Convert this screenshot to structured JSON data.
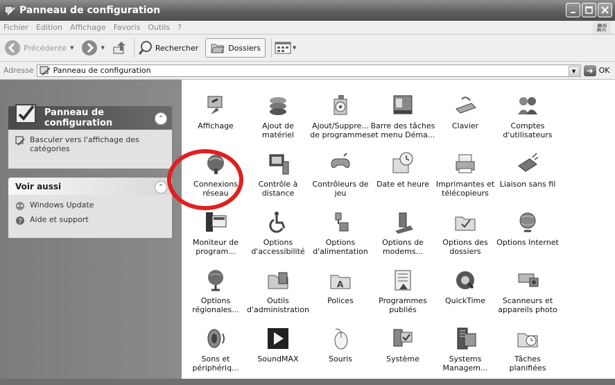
{
  "window": {
    "title": "Panneau de configuration"
  },
  "menu": [
    "Fichier",
    "Edition",
    "Affichage",
    "Favoris",
    "Outils",
    "?"
  ],
  "toolbar": {
    "back_label": "Précédente",
    "search_label": "Rechercher",
    "folders_label": "Dossiers"
  },
  "address": {
    "label": "Adresse",
    "value": "Panneau de configuration",
    "go_label": "OK"
  },
  "left_panel": {
    "control_panel": {
      "title": "Panneau de configuration",
      "switch_view": "Basculer vers l'affichage des catégories"
    },
    "see_also": {
      "title": "Voir aussi",
      "links": [
        "Windows Update",
        "Aide et support"
      ]
    }
  },
  "items": [
    {
      "label": "Affichage",
      "icon": "display-icon"
    },
    {
      "label": "Ajout de matériel",
      "icon": "add-hardware-icon"
    },
    {
      "label": "Ajout/Suppre... de programmes",
      "icon": "add-remove-programs-icon"
    },
    {
      "label": "Barre des tâches et menu Déma...",
      "icon": "taskbar-icon"
    },
    {
      "label": "Clavier",
      "icon": "keyboard-icon"
    },
    {
      "label": "Comptes d'utilisateurs",
      "icon": "user-accounts-icon"
    },
    {
      "label": "Connexions réseau",
      "icon": "network-icon"
    },
    {
      "label": "Contrôle à distance",
      "icon": "remote-control-icon"
    },
    {
      "label": "Contrôleurs de jeu",
      "icon": "gamepad-icon"
    },
    {
      "label": "Date et heure",
      "icon": "clock-icon"
    },
    {
      "label": "Imprimantes et télécopieurs",
      "icon": "printer-icon"
    },
    {
      "label": "Liaison sans fil",
      "icon": "wireless-icon"
    },
    {
      "label": "Moniteur de program...",
      "icon": "monitor-program-icon"
    },
    {
      "label": "Options d'accessibilité",
      "icon": "accessibility-icon"
    },
    {
      "label": "Options d'alimentation",
      "icon": "power-icon"
    },
    {
      "label": "Options de modems...",
      "icon": "modem-icon"
    },
    {
      "label": "Options des dossiers",
      "icon": "folder-options-icon"
    },
    {
      "label": "Options Internet",
      "icon": "internet-options-icon"
    },
    {
      "label": "Options régionales...",
      "icon": "globe-icon"
    },
    {
      "label": "Outils d'administration",
      "icon": "admin-tools-icon"
    },
    {
      "label": "Polices",
      "icon": "fonts-icon"
    },
    {
      "label": "Programmes publiés",
      "icon": "published-programs-icon"
    },
    {
      "label": "QuickTime",
      "icon": "quicktime-icon"
    },
    {
      "label": "Scanneurs et appareils photo",
      "icon": "scanner-icon"
    },
    {
      "label": "Sons et périphériq...",
      "icon": "speaker-icon"
    },
    {
      "label": "SoundMAX",
      "icon": "soundmax-icon"
    },
    {
      "label": "Souris",
      "icon": "mouse-icon"
    },
    {
      "label": "Système",
      "icon": "system-icon"
    },
    {
      "label": "Systems Managem...",
      "icon": "systems-management-icon"
    },
    {
      "label": "Tâches planifiées",
      "icon": "scheduled-tasks-icon"
    }
  ],
  "colors": {
    "highlight_circle": "#e02020"
  }
}
